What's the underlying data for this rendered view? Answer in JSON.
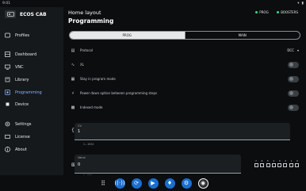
{
  "status": {
    "time": "9:01",
    "wifi_icon": "wifi-icon",
    "battery_icon": "battery-icon"
  },
  "app": {
    "title": "ECOS CAB"
  },
  "sidebar": {
    "items": [
      {
        "label": "Profiles",
        "icon": "profile-icon"
      },
      {
        "label": "Dashboard",
        "icon": "dashboard-icon"
      },
      {
        "label": "VNC",
        "icon": "monitor-icon"
      },
      {
        "label": "Library",
        "icon": "library-icon"
      },
      {
        "label": "Programming",
        "icon": "programming-icon"
      },
      {
        "label": "Device",
        "icon": "device-icon"
      },
      {
        "label": "Settings",
        "icon": "settings-icon"
      },
      {
        "label": "License",
        "icon": "license-icon"
      },
      {
        "label": "About",
        "icon": "info-icon"
      }
    ]
  },
  "header": {
    "breadcrumb": "Home layout",
    "title": "Programming"
  },
  "status_pills": [
    {
      "label": "PROG",
      "color": "#3ddc84"
    },
    {
      "label": "BOOSTERS",
      "color": "#3ddc84"
    }
  ],
  "tabs": [
    {
      "label": "PROG",
      "selected": true
    },
    {
      "label": "MAIN",
      "selected": false
    }
  ],
  "settings": {
    "protocol": {
      "label": "Protocol",
      "value": "DCC"
    },
    "xl": {
      "label": "XL"
    },
    "stay": {
      "label": "Stay in program mode"
    },
    "power": {
      "label": "Power down option between programming steps"
    },
    "indexed": {
      "label": "Indexed mode"
    }
  },
  "cv": {
    "label": "CV",
    "value": "1",
    "hint": "1...1024",
    "icon_text": "{x}"
  },
  "cv_value": {
    "label": "Value",
    "value": "0",
    "hint": "0...255"
  },
  "bits": [
    "7",
    "6",
    "5",
    "4",
    "3",
    "2",
    "1",
    "0"
  ],
  "dock": [
    "apps-icon",
    "wireless-icon",
    "sync-icon",
    "video-icon",
    "train-icon",
    "settings-icon",
    "home-icon"
  ]
}
